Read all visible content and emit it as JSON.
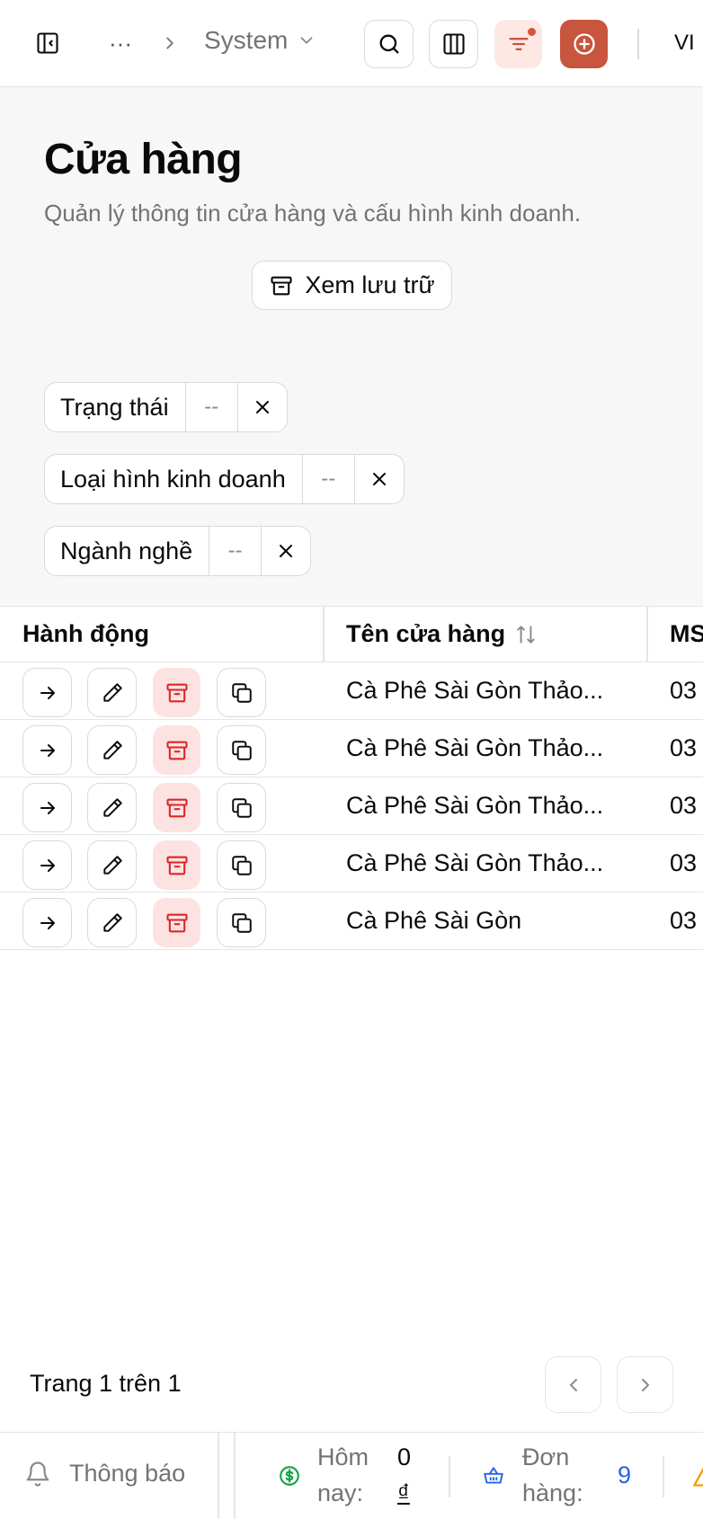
{
  "topbar": {
    "toggle_sidebar_icon": "sidebar-toggle-icon",
    "breadcrumb_more": "···",
    "breadcrumb_current": "System",
    "language": "VI",
    "colors": {
      "filter_active_bg": "#fde8e4",
      "add_bg": "#c8553d",
      "dot": "#d9533b"
    }
  },
  "header": {
    "title": "Cửa hàng",
    "subtitle": "Quản lý thông tin cửa hàng và cấu hình kinh doanh.",
    "archive_label": "Xem lưu trữ"
  },
  "filters": [
    {
      "label": "Trạng thái",
      "value": "--"
    },
    {
      "label": "Loại hình kinh doanh",
      "value": "--"
    },
    {
      "label": "Ngành nghề",
      "value": "--"
    }
  ],
  "table": {
    "columns": [
      "Hành động",
      "Tên cửa hàng",
      "MS"
    ],
    "rows": [
      {
        "name": "Cà Phê Sài Gòn Thảo...",
        "ms": "03"
      },
      {
        "name": "Cà Phê Sài Gòn Thảo...",
        "ms": "03"
      },
      {
        "name": "Cà Phê Sài Gòn Thảo...",
        "ms": "03"
      },
      {
        "name": "Cà Phê Sài Gòn Thảo...",
        "ms": "03"
      },
      {
        "name": "Cà Phê Sài Gòn",
        "ms": "03"
      }
    ]
  },
  "pagination": {
    "info": "Trang 1 trên 1"
  },
  "footer": {
    "notifications": "Thông báo",
    "today_label_1": "Hôm",
    "today_label_2": "nay:",
    "today_value_1": "0",
    "today_value_2": "₫",
    "orders_label_1": "Đơn",
    "orders_label_2": "hàng:",
    "orders_value": "9",
    "colors": {
      "money": "#16a34a",
      "orders": "#2563eb",
      "warning": "#f59e0b"
    }
  }
}
